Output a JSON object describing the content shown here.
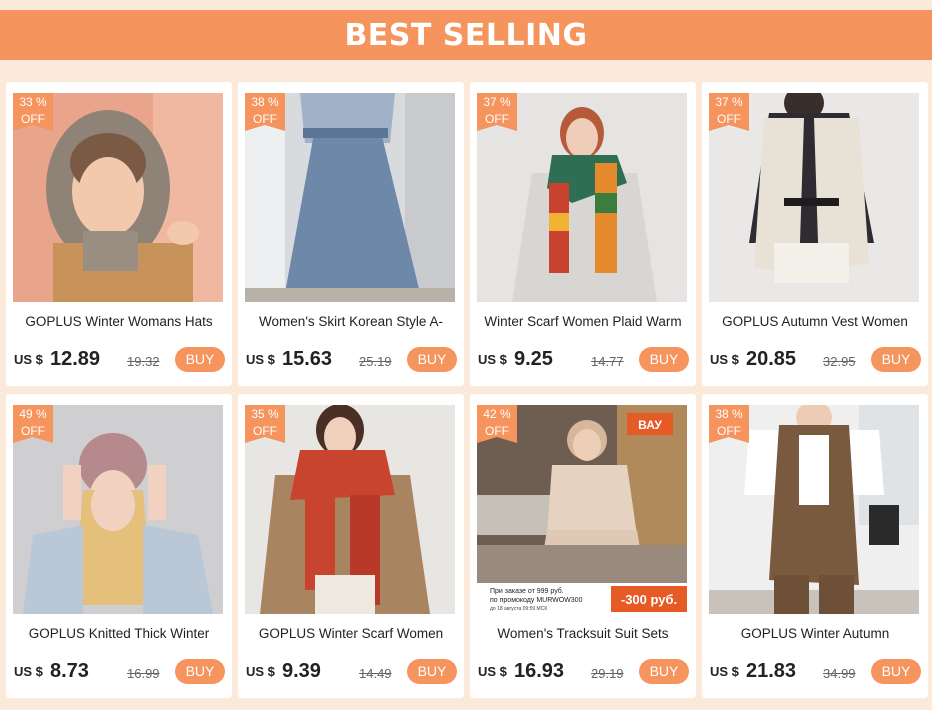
{
  "banner": {
    "title": "BEST SELLING"
  },
  "colors": {
    "accent": "#f5945d",
    "background": "#fbe9da"
  },
  "products": [
    {
      "title": "GOPLUS Winter Womans Hats",
      "discount_pct": "33 %",
      "discount_off": "OFF",
      "currency": "US $",
      "price": "12.89",
      "old_price": "19.32",
      "buy": "BUY"
    },
    {
      "title": "Women's Skirt Korean Style A-",
      "discount_pct": "38 %",
      "discount_off": "OFF",
      "currency": "US $",
      "price": "15.63",
      "old_price": "25.19",
      "buy": "BUY"
    },
    {
      "title": "Winter Scarf Women Plaid Warm",
      "discount_pct": "37 %",
      "discount_off": "OFF",
      "currency": "US $",
      "price": "9.25",
      "old_price": "14.77",
      "buy": "BUY"
    },
    {
      "title": "GOPLUS Autumn Vest Women",
      "discount_pct": "37 %",
      "discount_off": "OFF",
      "currency": "US $",
      "price": "20.85",
      "old_price": "32.95",
      "buy": "BUY"
    },
    {
      "title": "GOPLUS Knitted Thick Winter",
      "discount_pct": "49 %",
      "discount_off": "OFF",
      "currency": "US $",
      "price": "8.73",
      "old_price": "16.99",
      "buy": "BUY"
    },
    {
      "title": "GOPLUS Winter Scarf Women",
      "discount_pct": "35 %",
      "discount_off": "OFF",
      "currency": "US $",
      "price": "9.39",
      "old_price": "14.49",
      "buy": "BUY"
    },
    {
      "title": "Women's Tracksuit Suit Sets",
      "discount_pct": "42 %",
      "discount_off": "OFF",
      "currency": "US $",
      "price": "16.93",
      "old_price": "29.19",
      "buy": "BUY"
    },
    {
      "title": "GOPLUS Winter Autumn",
      "discount_pct": "38 %",
      "discount_off": "OFF",
      "currency": "US $",
      "price": "21.83",
      "old_price": "34.99",
      "buy": "BUY"
    }
  ],
  "promo": {
    "line1": "При заказе от 999 руб.",
    "line2": "по промокоду MURWOW300",
    "line3": "до 18 августа 09:59 МСК",
    "discount": "-300 руб.",
    "sign": "ВАУ"
  }
}
